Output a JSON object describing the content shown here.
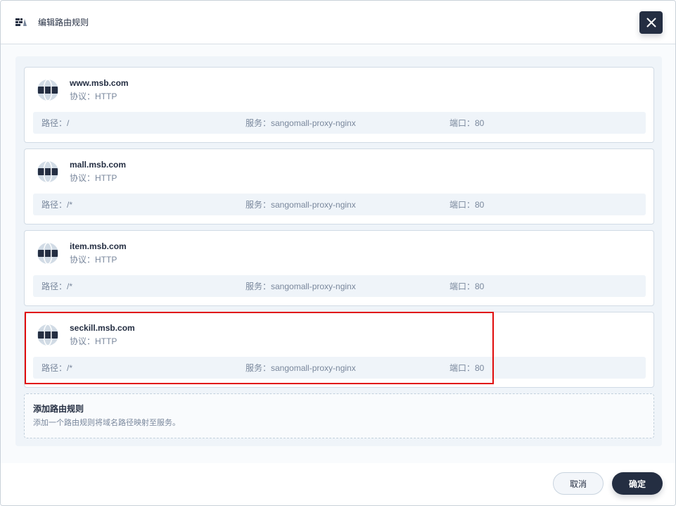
{
  "dialog": {
    "title": "编辑路由规则",
    "close_icon": "close-icon",
    "header_icon": "route-rules-icon"
  },
  "rules": [
    {
      "host": "www.msb.com",
      "protocol": "协议：HTTP",
      "path": "路径：/",
      "service": "服务：sangomall-proxy-nginx",
      "port": "端口：80"
    },
    {
      "host": "mall.msb.com",
      "protocol": "协议：HTTP",
      "path": "路径：/*",
      "service": "服务：sangomall-proxy-nginx",
      "port": "端口：80"
    },
    {
      "host": "item.msb.com",
      "protocol": "协议：HTTP",
      "path": "路径：/*",
      "service": "服务：sangomall-proxy-nginx",
      "port": "端口：80"
    },
    {
      "host": "seckill.msb.com",
      "protocol": "协议：HTTP",
      "path": "路径：/*",
      "service": "服务：sangomall-proxy-nginx",
      "port": "端口：80"
    }
  ],
  "add_rule": {
    "title": "添加路由规则",
    "description": "添加一个路由规则将域名路径映射至服务。"
  },
  "footer": {
    "cancel_label": "取消",
    "confirm_label": "确定"
  },
  "colors": {
    "primary_dark": "#242e42",
    "muted_text": "#79879c",
    "highlight_border": "#e00b0b"
  }
}
